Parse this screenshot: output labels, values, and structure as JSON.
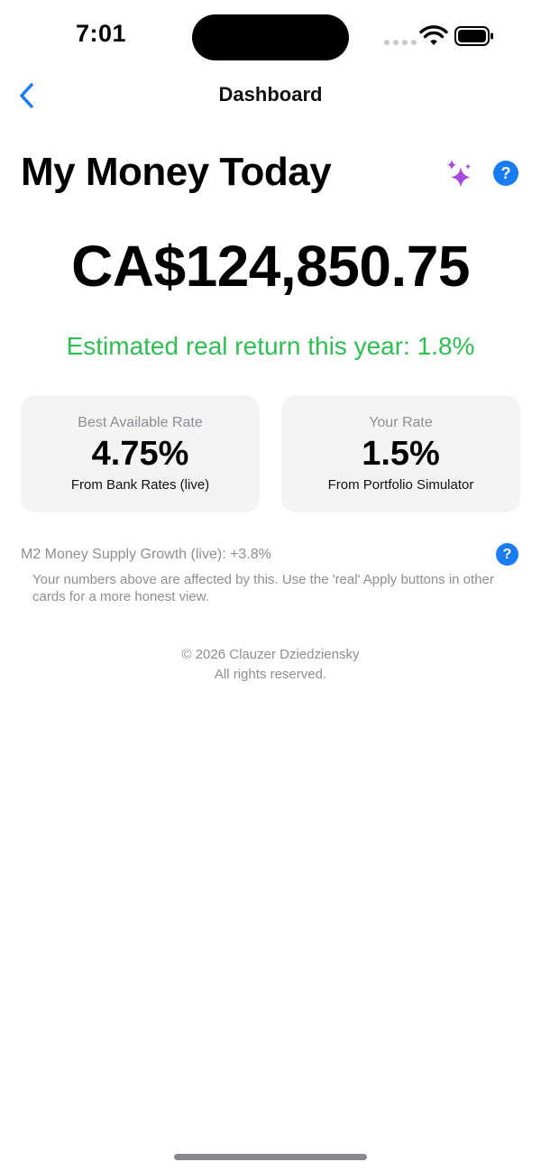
{
  "status_bar": {
    "time": "7:01"
  },
  "nav": {
    "title": "Dashboard"
  },
  "header": {
    "title": "My Money Today",
    "help_label": "?"
  },
  "balance": {
    "amount": "CA$124,850.75",
    "real_return_text": "Estimated real return this year: 1.8%"
  },
  "cards": [
    {
      "label": "Best Available Rate",
      "value": "4.75%",
      "source": "From Bank Rates (live)"
    },
    {
      "label": "Your Rate",
      "value": "1.5%",
      "source": "From Portfolio Simulator"
    }
  ],
  "m2": {
    "line": "M2 Money Supply Growth (live): +3.8%",
    "note": "Your numbers above are affected by this. Use the 'real' Apply buttons in other cards for a more honest view.",
    "help_label": "?"
  },
  "footer": {
    "copyright": "© 2026 Clauzer Dziedziensky",
    "rights": "All rights reserved."
  },
  "colors": {
    "accent": "#1a7cf2",
    "positive": "#2fbe52",
    "sparkle": "#a64bdb",
    "card_bg": "#f4f4f5",
    "secondary_text": "#8e8e93"
  }
}
